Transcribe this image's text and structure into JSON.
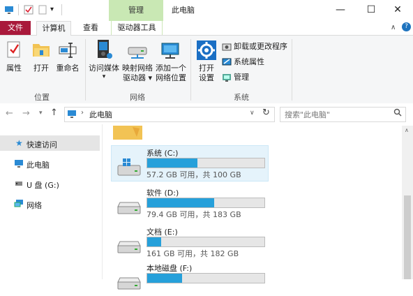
{
  "window": {
    "title": "此电脑",
    "context_tab": "管理",
    "minimize_glyph": "—",
    "maximize_glyph": "☐",
    "close_glyph": "✕"
  },
  "ribbon": {
    "tabs": {
      "file": "文件",
      "computer": "计算机",
      "view": "查看",
      "drive_tools": "驱动器工具"
    },
    "location_group": {
      "label": "位置",
      "properties": "属性",
      "open": "打开",
      "rename": "重命名"
    },
    "network_group": {
      "label": "网络",
      "access_media_l1": "访问媒体",
      "access_media_l2": "▾",
      "map_drive_l1": "映射网络",
      "map_drive_l2": "驱动器 ▾",
      "add_location_l1": "添加一个",
      "add_location_l2": "网络位置"
    },
    "system_group": {
      "label": "系统",
      "open_settings_l1": "打开",
      "open_settings_l2": "设置",
      "uninstall": "卸载或更改程序",
      "system_properties": "系统属性",
      "manage": "管理"
    }
  },
  "address": {
    "path": "此电脑",
    "search_placeholder": "搜索\"此电脑\""
  },
  "nav_pane": {
    "items": [
      {
        "label": "快速访问"
      },
      {
        "label": "此电脑"
      },
      {
        "label": "U 盘 (G:)"
      },
      {
        "label": "网络"
      }
    ]
  },
  "drives": [
    {
      "name": "系统 (C:)",
      "free": "57.2 GB 可用，共 100 GB",
      "used_fraction": 0.43
    },
    {
      "name": "软件 (D:)",
      "free": "79.4 GB 可用，共 183 GB",
      "used_fraction": 0.57
    },
    {
      "name": "文档 (E:)",
      "free": "161 GB 可用，共 182 GB",
      "used_fraction": 0.12
    },
    {
      "name": "本地磁盘 (F:)",
      "free": "",
      "used_fraction": 0.3
    }
  ],
  "colors": {
    "file_tab": "#a9193b",
    "context_tab": "#c9e8b4",
    "bar_fill": "#26a0da",
    "selection": "#e5f3fb"
  }
}
